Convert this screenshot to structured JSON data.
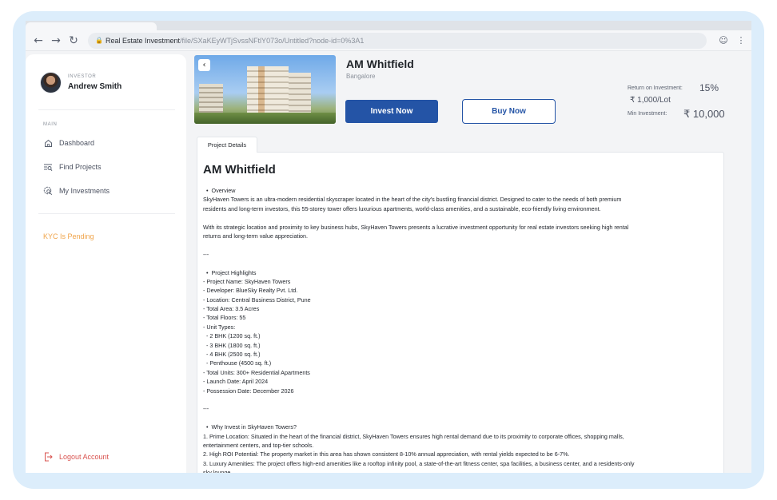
{
  "browser": {
    "url_host": "Real Estate Investment",
    "url_path": "/file/SXaKEyWTjSvssNFtlY073o/Untitled?node-id=0%3A1"
  },
  "user": {
    "role": "INVESTOR",
    "name": "Andrew Smith"
  },
  "sidebar": {
    "section": "MAIN",
    "items": [
      {
        "label": "Dashboard",
        "icon": "home-icon"
      },
      {
        "label": "Find Projects",
        "icon": "filter-search-icon"
      },
      {
        "label": "My Investments",
        "icon": "investment-search-icon"
      }
    ],
    "kyc": "KYC Is Pending",
    "logout": "Logout Account"
  },
  "project": {
    "name": "AM Whitfield",
    "city": "Bangalore",
    "invest_button": "Invest Now",
    "buy_button": "Buy Now",
    "roi_label": "Return on Investment:",
    "roi_value": "15%",
    "lot_price": "₹ 1,000/Lot",
    "min_label": "Min Investment:",
    "min_value": "₹ 10,000"
  },
  "details": {
    "tab": "Project Details",
    "title": "AM Whitfield",
    "lines": [
      "  •  Overview",
      "SkyHaven Towers is an ultra-modern residential skyscraper located in the heart of the city's bustling financial district. Designed to cater to the needs of both premium",
      "residents and long-term investors, this 55-storey tower offers luxurious apartments, world-class amenities, and a sustainable, eco-friendly living environment.",
      "",
      "With its strategic location and proximity to key business hubs, SkyHaven Towers presents a lucrative investment opportunity for real estate investors seeking high rental",
      "returns and long-term value appreciation.",
      "",
      "---",
      "",
      "  •  Project Highlights",
      "- Project Name: SkyHaven Towers",
      "- Developer: BlueSky Realty Pvt. Ltd.",
      "- Location: Central Business District, Pune",
      "- Total Area: 3.5 Acres",
      "- Total Floors: 55",
      "- Unit Types:",
      "  - 2 BHK (1200 sq. ft.)",
      "  - 3 BHK (1800 sq. ft.)",
      "  - 4 BHK (2500 sq. ft.)",
      "  - Penthouse (4500 sq. ft.)",
      "- Total Units: 300+ Residential Apartments",
      "- Launch Date: April 2024",
      "- Possession Date: December 2026",
      "",
      "---",
      "",
      "  •  Why Invest in SkyHaven Towers?",
      "1. Prime Location: Situated in the heart of the financial district, SkyHaven Towers ensures high rental demand due to its proximity to corporate offices, shopping malls,",
      "entertainment centers, and top-tier schools.",
      "2. High ROI Potential: The property market in this area has shown consistent 8-10% annual appreciation, with rental yields expected to be 6-7%.",
      "3. Luxury Amenities: The project offers high-end amenities like a rooftop infinity pool, a state-of-the-art fitness center, spa facilities, a business center, and a residents-only",
      "sky lounge."
    ]
  }
}
